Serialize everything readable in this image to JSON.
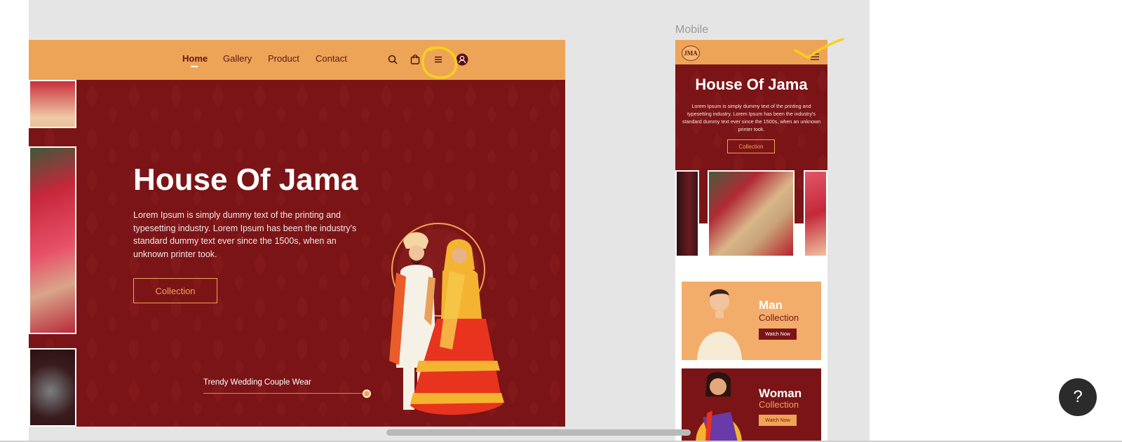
{
  "desktop": {
    "nav": {
      "links": [
        "Home",
        "Gallery",
        "Product",
        "Contact"
      ],
      "active": "Home",
      "icons": [
        "search-icon",
        "shopping-bag-icon",
        "hamburger-menu-icon",
        "user-icon"
      ]
    },
    "hero": {
      "title": "House Of Jama",
      "description": "Lorem Ipsum is simply dummy text of the printing and typesetting industry. Lorem Ipsum has been the industry's standard dummy text ever since the 1500s, when an unknown printer took.",
      "button_label": "Collection",
      "slide_caption": "Trendy Wedding Couple Wear"
    }
  },
  "mobile": {
    "label": "Mobile",
    "logo_text": "JMA",
    "hero": {
      "title": "House Of Jama",
      "description": "Lorem Ipsum is simply dummy text of the printing and typesetting industry. Lorem Ipsum has been the industry's standard dummy text ever since the 1500s, when an unknown printer took.",
      "button_label": "Collection"
    },
    "cards": [
      {
        "title": "Man",
        "subtitle": "Collection",
        "button_label": "Watch Now"
      },
      {
        "title": "Woman",
        "subtitle": "Collection",
        "button_label": "Watch Now"
      }
    ]
  },
  "help_label": "?",
  "colors": {
    "primary_maroon": "#7b1416",
    "accent_orange": "#eea457",
    "annotation_yellow": "#f5d11d",
    "canvas_gray": "#e5e5e5"
  }
}
